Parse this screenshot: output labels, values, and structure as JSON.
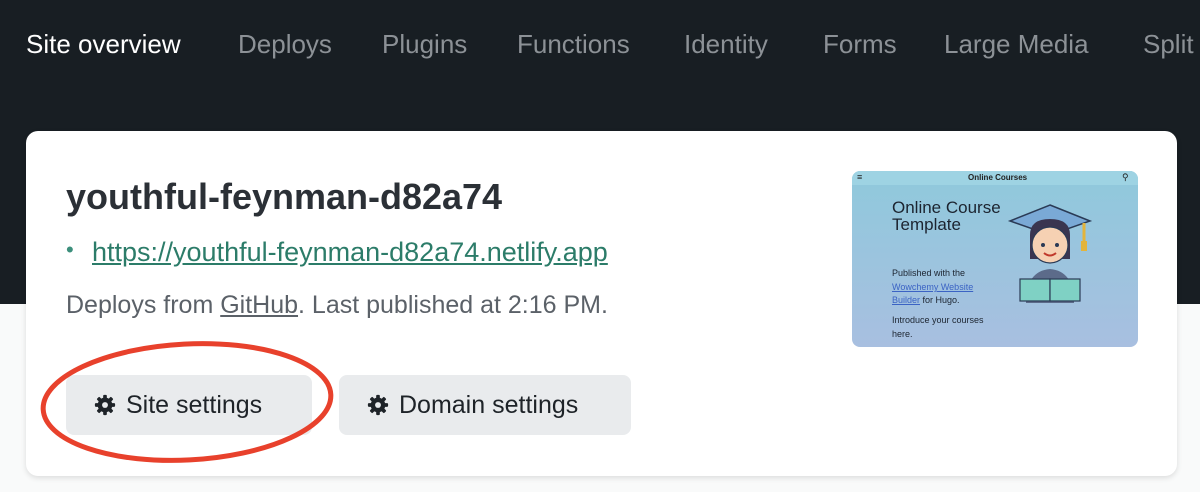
{
  "nav": {
    "tabs": [
      {
        "label": "Site overview",
        "active": true
      },
      {
        "label": "Deploys"
      },
      {
        "label": "Plugins"
      },
      {
        "label": "Functions"
      },
      {
        "label": "Identity"
      },
      {
        "label": "Forms"
      },
      {
        "label": "Large Media"
      },
      {
        "label": "Split"
      }
    ]
  },
  "site": {
    "name": "youthful-feynman-d82a74",
    "url": "https://youthful-feynman-d82a74.netlify.app",
    "deploy_prefix": "Deploys from ",
    "deploy_source": "GitHub",
    "deploy_suffix": ". Last published at 2:16 PM."
  },
  "buttons": {
    "site_settings": "Site settings",
    "domain_settings": "Domain settings"
  },
  "thumbnail": {
    "menu": "≡",
    "header": "Online Courses",
    "search": "⚲",
    "heading": "Online Course Template",
    "line1": "Published with the",
    "link1": "Wowchemy Website",
    "link2": "Builder",
    "line2_suffix": " for Hugo.",
    "line3": "Introduce your courses",
    "line4": "here."
  },
  "colors": {
    "topbar": "#181e23",
    "accent": "#2c7c69",
    "highlight": "#e8412c"
  }
}
